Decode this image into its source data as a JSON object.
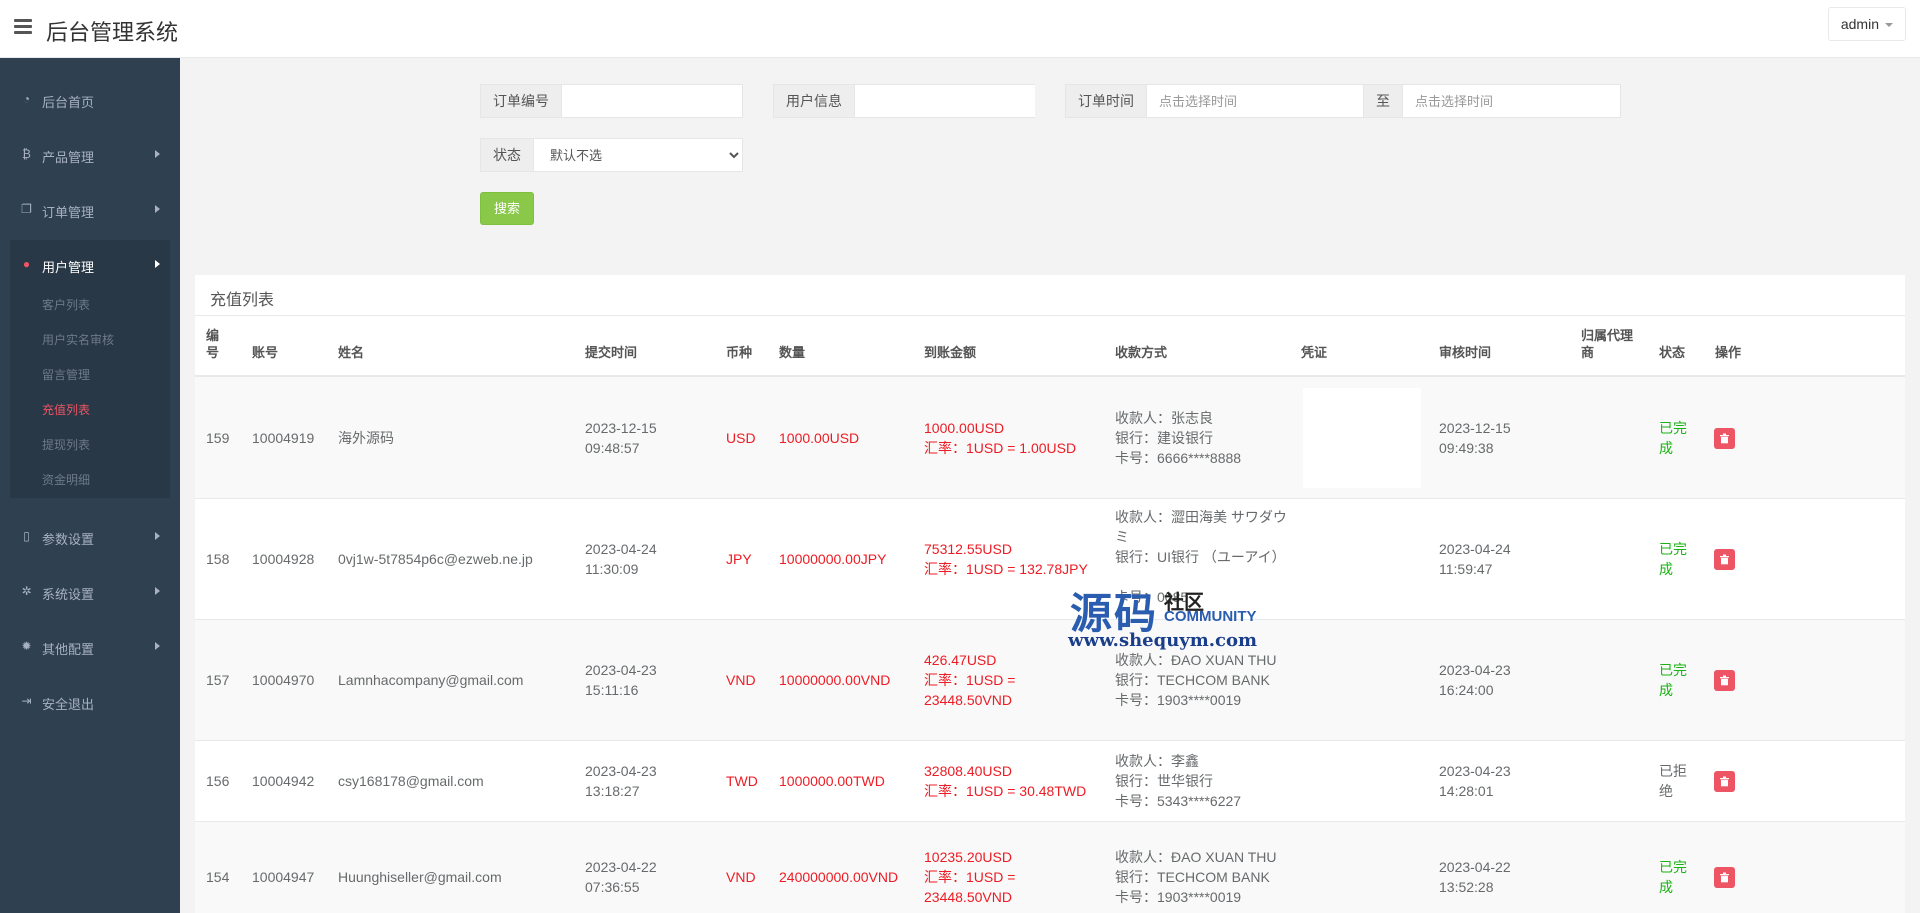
{
  "header": {
    "title": "后台管理系统",
    "user": "admin"
  },
  "sidebar": {
    "items": [
      {
        "label": "后台首页",
        "icon": "dashboard-icon"
      },
      {
        "label": "产品管理",
        "icon": "bitcoin-icon"
      },
      {
        "label": "订单管理",
        "icon": "copy-icon"
      },
      {
        "label": "用户管理",
        "icon": "user-icon"
      },
      {
        "label": "参数设置",
        "icon": "file-icon"
      },
      {
        "label": "系统设置",
        "icon": "cogs-icon"
      },
      {
        "label": "其他配置",
        "icon": "gear-icon"
      },
      {
        "label": "安全退出",
        "icon": "sign-out-icon"
      }
    ],
    "sub_items": [
      "客户列表",
      "用户实名审核",
      "留言管理",
      "充值列表",
      "提现列表",
      "资金明细"
    ]
  },
  "search": {
    "order_no_label": "订单编号",
    "user_info_label": "用户信息",
    "order_time_label": "订单时间",
    "time_placeholder": "点击选择时间",
    "to_label": "至",
    "status_label": "状态",
    "status_value": "默认不选",
    "search_button": "搜索"
  },
  "table": {
    "title": "充值列表",
    "columns": {
      "no": "编号",
      "account": "账号",
      "name": "姓名",
      "submit_time": "提交时间",
      "currency": "币种",
      "amount": "数量",
      "received": "到账金额",
      "payment": "收款方式",
      "voucher": "凭证",
      "audit_time": "审核时间",
      "agent": "归属代理商",
      "status": "状态",
      "action": "操作"
    },
    "rows": [
      {
        "no": "159",
        "account": "10004919",
        "name": "海外源码",
        "submit_time": "2023-12-15 09:48:57",
        "currency": "USD",
        "amount": "1000.00USD",
        "received": "1000.00USD",
        "rate": "汇率：1USD = 1.00USD",
        "payee": "收款人：张志良",
        "bank": "银行：建设银行",
        "card": "卡号：6666****8888",
        "audit_time": "2023-12-15 09:49:38",
        "status": "已完成"
      },
      {
        "no": "158",
        "account": "10004928",
        "name": "0vj1w-5t7854p6c@ezweb.ne.jp",
        "submit_time": "2023-04-24 11:30:09",
        "currency": "JPY",
        "amount": "10000000.00JPY",
        "received": "75312.55USD",
        "rate": "汇率：1USD = 132.78JPY",
        "payee": "收款人：澀田海美 サワダウミ",
        "bank": "银行：UI银行 （ユーアイ）",
        "card": "卡号：0085",
        "audit_time": "2023-04-24 11:59:47",
        "status": "已完成"
      },
      {
        "no": "157",
        "account": "10004970",
        "name": "Lamnhacompany@gmail.com",
        "submit_time": "2023-04-23 15:11:16",
        "currency": "VND",
        "amount": "10000000.00VND",
        "received": "426.47USD",
        "rate": "汇率：1USD = 23448.50VND",
        "payee": "收款人：ĐAO XUAN THU",
        "bank": "银行：TECHCOM BANK",
        "card": "卡号：1903****0019",
        "audit_time": "2023-04-23 16:24:00",
        "status": "已完成"
      },
      {
        "no": "156",
        "account": "10004942",
        "name": "csy168178@gmail.com",
        "submit_time": "2023-04-23 13:18:27",
        "currency": "TWD",
        "amount": "1000000.00TWD",
        "received": "32808.40USD",
        "rate": "汇率：1USD = 30.48TWD",
        "payee": "收款人：李鑫",
        "bank": "银行：世华银行",
        "card": "卡号：5343****6227",
        "audit_time": "2023-04-23 14:28:01",
        "status": "已拒绝"
      },
      {
        "no": "154",
        "account": "10004947",
        "name": "Huunghiseller@gmail.com",
        "submit_time": "2023-04-22 07:36:55",
        "currency": "VND",
        "amount": "240000000.00VND",
        "received": "10235.20USD",
        "rate": "汇率：1USD = 23448.50VND",
        "payee": "收款人：ĐAO XUAN THU",
        "bank": "银行：TECHCOM BANK",
        "card": "卡号：1903****0019",
        "audit_time": "2023-04-22 13:52:28",
        "status": "已完成"
      }
    ]
  },
  "watermark": {
    "big": "源码",
    "cn": "社区",
    "en": "COMMUNITY",
    "url": "www.shequym.com"
  }
}
